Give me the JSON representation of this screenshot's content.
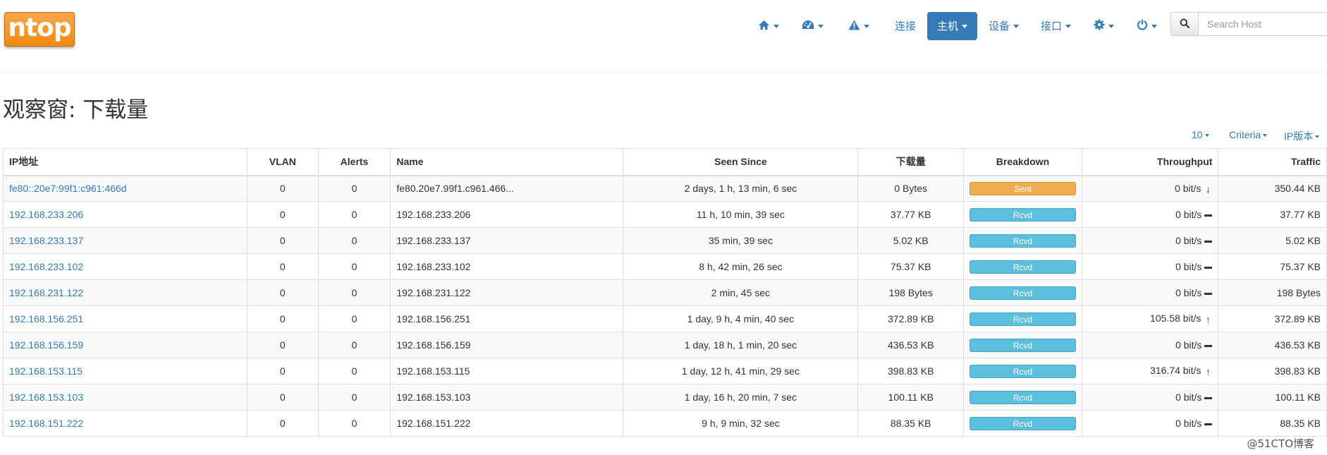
{
  "brand": {
    "logo_text": "ntop",
    "logo_color": "#f28c1c"
  },
  "nav": {
    "items": [
      {
        "icon": "home-icon"
      },
      {
        "icon": "dashboard-icon"
      },
      {
        "icon": "alert-icon"
      },
      {
        "label": "连接"
      },
      {
        "label": "主机",
        "active": true
      },
      {
        "label": "设备"
      },
      {
        "label": "接口"
      },
      {
        "icon": "gear-icon"
      },
      {
        "icon": "power-icon"
      }
    ]
  },
  "search": {
    "placeholder": "Search Host"
  },
  "page_title": "观察窗: 下载量",
  "table_toolbar": {
    "per_page": "10",
    "criteria": "Criteria",
    "ip_version": "IP版本"
  },
  "table": {
    "columns": [
      "IP地址",
      "VLAN",
      "Alerts",
      "Name",
      "Seen Since",
      "下载量",
      "Breakdown",
      "Throughput",
      "Traffic"
    ],
    "rows": [
      {
        "ip": "fe80::20e7:99f1:c961:466d",
        "vlan": "0",
        "alerts": "0",
        "name": "fe80.20e7.99f1.c961.466...",
        "seen": "2 days, 1 h, 13 min, 6 sec",
        "download": "0 Bytes",
        "breakdown": "Sent",
        "throughput": "0 bit/s",
        "trend": "down",
        "traffic": "350.44 KB"
      },
      {
        "ip": "192.168.233.206",
        "vlan": "0",
        "alerts": "0",
        "name": "192.168.233.206",
        "seen": "11 h, 10 min, 39 sec",
        "download": "37.77 KB",
        "breakdown": "Rcvd",
        "throughput": "0 bit/s",
        "trend": "flat",
        "traffic": "37.77 KB"
      },
      {
        "ip": "192.168.233.137",
        "vlan": "0",
        "alerts": "0",
        "name": "192.168.233.137",
        "seen": "35 min, 39 sec",
        "download": "5.02 KB",
        "breakdown": "Rcvd",
        "throughput": "0 bit/s",
        "trend": "flat",
        "traffic": "5.02 KB"
      },
      {
        "ip": "192.168.233.102",
        "vlan": "0",
        "alerts": "0",
        "name": "192.168.233.102",
        "seen": "8 h, 42 min, 26 sec",
        "download": "75.37 KB",
        "breakdown": "Rcvd",
        "throughput": "0 bit/s",
        "trend": "flat",
        "traffic": "75.37 KB"
      },
      {
        "ip": "192.168.231.122",
        "vlan": "0",
        "alerts": "0",
        "name": "192.168.231.122",
        "seen": "2 min, 45 sec",
        "download": "198 Bytes",
        "breakdown": "Rcvd",
        "throughput": "0 bit/s",
        "trend": "flat",
        "traffic": "198 Bytes"
      },
      {
        "ip": "192.168.156.251",
        "vlan": "0",
        "alerts": "0",
        "name": "192.168.156.251",
        "seen": "1 day, 9 h, 4 min, 40 sec",
        "download": "372.89 KB",
        "breakdown": "Rcvd",
        "throughput": "105.58 bit/s",
        "trend": "up",
        "traffic": "372.89 KB"
      },
      {
        "ip": "192.168.156.159",
        "vlan": "0",
        "alerts": "0",
        "name": "192.168.156.159",
        "seen": "1 day, 18 h, 1 min, 20 sec",
        "download": "436.53 KB",
        "breakdown": "Rcvd",
        "throughput": "0 bit/s",
        "trend": "flat",
        "traffic": "436.53 KB"
      },
      {
        "ip": "192.168.153.115",
        "vlan": "0",
        "alerts": "0",
        "name": "192.168.153.115",
        "seen": "1 day, 12 h, 41 min, 29 sec",
        "download": "398.83 KB",
        "breakdown": "Rcvd",
        "throughput": "316.74 bit/s",
        "trend": "up",
        "traffic": "398.83 KB"
      },
      {
        "ip": "192.168.153.103",
        "vlan": "0",
        "alerts": "0",
        "name": "192.168.153.103",
        "seen": "1 day, 16 h, 20 min, 7 sec",
        "download": "100.11 KB",
        "breakdown": "Rcvd",
        "throughput": "0 bit/s",
        "trend": "flat",
        "traffic": "100.11 KB"
      },
      {
        "ip": "192.168.151.222",
        "vlan": "0",
        "alerts": "0",
        "name": "192.168.151.222",
        "seen": "9 h, 9 min, 32 sec",
        "download": "88.35 KB",
        "breakdown": "Rcvd",
        "throughput": "0 bit/s",
        "trend": "flat",
        "traffic": "88.35 KB"
      }
    ]
  },
  "watermark": "@51CTO博客",
  "colors": {
    "link": "#337ab7",
    "active_nav": "#337ab7",
    "sent_bar": "#f0ad4e",
    "rcvd_bar": "#5bc0de"
  }
}
